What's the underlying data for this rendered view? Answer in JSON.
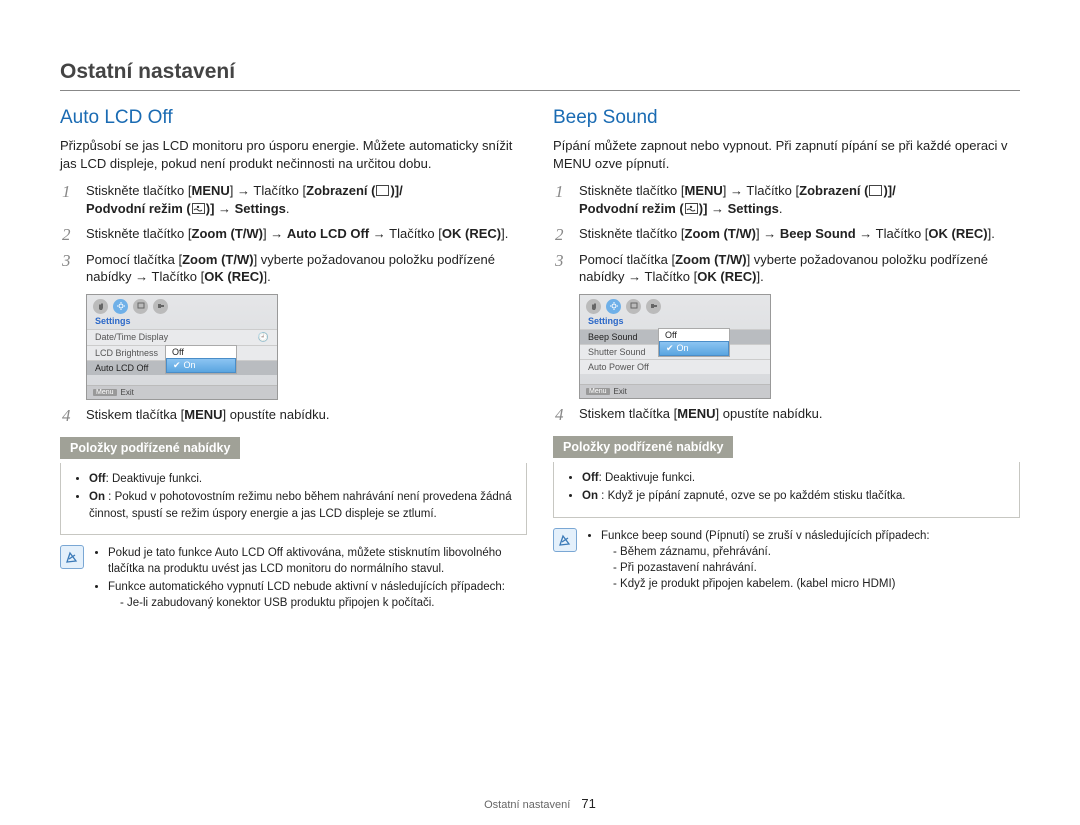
{
  "header": {
    "chapter": "Ostatní nastavení"
  },
  "left": {
    "title": "Auto LCD Off",
    "intro": "Přizpůsobí se jas LCD monitoru pro úsporu energie. Můžete automaticky snížit jas LCD displeje, pokud není produkt nečinnosti na určitou dobu.",
    "step1_a": "Stiskněte tlačítko [",
    "menu": "MENU",
    "step1_b": "] → Tlačítko [",
    "zobraz": "Zobrazení (",
    "step1_c": ")/",
    "step1_d": "Podvodní režim (",
    "step1_e": ")] → ",
    "settings": "Settings",
    "step2_a": "Stiskněte tlačítko [",
    "zoom": "Zoom (T/W)",
    "step2_b": "] → ",
    "feature": "Auto LCD Off",
    "step2_c": " → Tlačítko [",
    "okrec": "OK (REC)",
    "step2_d": "].",
    "step3_a": "Pomocí tlačítka [",
    "step3_b": "] vyberte požadovanou položku podřízené nabídky → Tlačítko [",
    "step3_c": "].",
    "step4_a": "Stiskem tlačítka [",
    "step4_b": "] opustíte nabídku.",
    "subheader": "Položky podřízené nabídky",
    "off_lbl": "Off",
    "off_txt": ": Deaktivuje funkci.",
    "on_lbl": "On",
    "on_txt": " : Pokud v pohotovostním režimu nebo během nahrávání není provedena žádná činnost, spustí se režim úspory energie a jas LCD displeje se ztlumí.",
    "note1": "Pokud je tato funkce Auto LCD Off aktivována, můžete stisknutím libovolného tlačítka na produktu uvést jas LCD monitoru do normálního stavul.",
    "note2": "Funkce automatického vypnutí LCD nebude aktivní v následujících případech:",
    "note2a": "- Je-li zabudovaný konektor USB produktu připojen k počítači.",
    "shot": {
      "settings": "Settings",
      "r1": "Date/Time Display",
      "r2": "LCD Brightness",
      "r3": "Auto LCD Off",
      "off": "Off",
      "on": "On",
      "exit": "Exit",
      "menu": "Menu"
    }
  },
  "right": {
    "title": "Beep Sound",
    "intro": "Pípání můžete zapnout nebo vypnout. Při zapnutí pípání se při každé operaci v MENU ozve pípnutí.",
    "step2_feature": "Beep Sound",
    "subheader": "Položky podřízené nabídky",
    "off_txt": ": Deaktivuje funkci.",
    "on_txt": " : Když je pípání zapnuté, ozve se po každém stisku tlačítka.",
    "note1": "Funkce beep sound (Pípnutí) se zruší v následujících případech:",
    "note1a": "- Během záznamu, přehrávání.",
    "note1b": "- Při pozastavení nahrávání.",
    "note1c": "- Když je produkt připojen kabelem. (kabel micro HDMI)",
    "shot": {
      "settings": "Settings",
      "r1": "Beep Sound",
      "r2": "Shutter Sound",
      "r3": "Auto Power Off",
      "off": "Off",
      "on": "On",
      "exit": "Exit",
      "menu": "Menu"
    }
  },
  "footer": {
    "label": "Ostatní nastavení",
    "page": "71"
  }
}
